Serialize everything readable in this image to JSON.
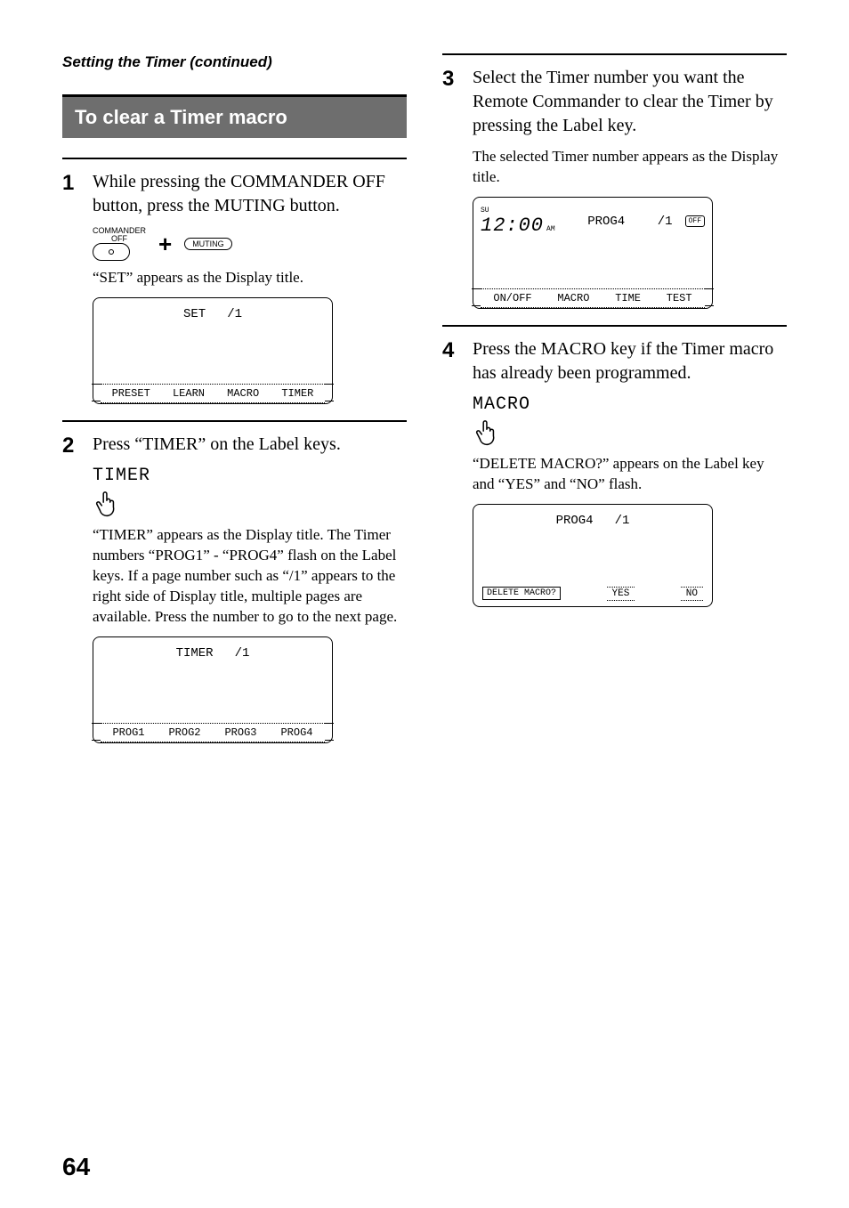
{
  "page": {
    "running_head": "Setting the Timer (continued)",
    "section_title": "To clear a Timer macro",
    "page_number": "64"
  },
  "buttons": {
    "commander_caption": "COMMANDER",
    "off_caption": "OFF",
    "plus": "+",
    "muting_label": "MUTING"
  },
  "steps": {
    "s1": {
      "num": "1",
      "main": "While pressing the COMMANDER OFF button, press the MUTING button.",
      "sub": "“SET” appears as the Display title."
    },
    "s2": {
      "num": "2",
      "main": "Press “TIMER” on the Label keys.",
      "key_word": "TIMER",
      "sub": "“TIMER” appears as the Display title. The Timer numbers “PROG1” - “PROG4” flash on the Label keys. If a page number such as “/1” appears to the right side of Display title, multiple pages are available. Press the number to go to the next page."
    },
    "s3": {
      "num": "3",
      "main": "Select the Timer number you want the Remote Commander to clear the Timer by pressing the Label key.",
      "sub": "The selected Timer number appears as the Display title."
    },
    "s4": {
      "num": "4",
      "main": "Press the MACRO key if the Timer macro has already been programmed.",
      "key_word": "MACRO",
      "sub": "“DELETE MACRO?” appears on the Label key and “YES” and “NO” flash."
    }
  },
  "displays": {
    "set": {
      "title": "SET",
      "page": "/1",
      "labels": [
        "PRESET",
        "LEARN",
        "MACRO",
        "TIMER"
      ]
    },
    "timer": {
      "title": "TIMER",
      "page": "/1",
      "labels": [
        "PROG1",
        "PROG2",
        "PROG3",
        "PROG4"
      ]
    },
    "prog4_clock": {
      "day": "SU",
      "clock": "12:00",
      "ampm": "AM",
      "title": "PROG4",
      "page": "/1",
      "off_badge": "OFF",
      "labels": [
        "ON/OFF",
        "MACRO",
        "TIME",
        "TEST"
      ]
    },
    "delete": {
      "title": "PROG4",
      "page": "/1",
      "prompt": "DELETE MACRO?",
      "yes": "YES",
      "no": "NO"
    }
  }
}
